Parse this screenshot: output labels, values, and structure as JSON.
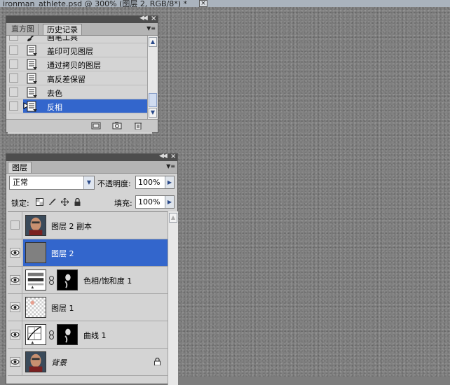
{
  "document": {
    "title": "ironman_athlete.psd @ 300% (图层 2, RGB/8*) *",
    "close_glyph": "×"
  },
  "history_panel": {
    "tabs": [
      {
        "label": "直方图",
        "active": false
      },
      {
        "label": "历史记录",
        "active": true
      }
    ],
    "items": [
      {
        "label": "画笔工具",
        "icon": "brush-icon",
        "selected": false
      },
      {
        "label": "盖印可见图层",
        "icon": "history-state-icon",
        "selected": false
      },
      {
        "label": "通过拷贝的图层",
        "icon": "history-state-icon",
        "selected": false
      },
      {
        "label": "高反差保留",
        "icon": "history-state-icon",
        "selected": false
      },
      {
        "label": "去色",
        "icon": "history-state-icon",
        "selected": false
      },
      {
        "label": "反相",
        "icon": "history-state-icon",
        "selected": true
      }
    ],
    "footer_icons": [
      "new-document-from-state-icon",
      "snapshot-camera-icon",
      "trash-icon"
    ]
  },
  "layers_panel": {
    "tab_label": "图层",
    "blend_mode": "正常",
    "opacity_label": "不透明度:",
    "opacity_value": "100%",
    "lock_label": "锁定:",
    "fill_label": "填充:",
    "fill_value": "100%",
    "layers": [
      {
        "name": "图层 2 副本",
        "visible": false,
        "selected": false,
        "thumb": "photo"
      },
      {
        "name": "图层 2",
        "visible": true,
        "selected": true,
        "thumb": "gray"
      },
      {
        "name": "色相/饱和度 1",
        "visible": true,
        "selected": false,
        "thumb": "adjust-hue",
        "has_mask": true
      },
      {
        "name": "图层 1",
        "visible": true,
        "selected": false,
        "thumb": "transparent"
      },
      {
        "name": "曲线 1",
        "visible": true,
        "selected": false,
        "thumb": "curves",
        "has_mask": true
      },
      {
        "name": "背景",
        "visible": true,
        "selected": false,
        "thumb": "photo",
        "locked": true
      }
    ]
  },
  "colors": {
    "selection": "#3366cc",
    "panel_bg": "#d4d4d4",
    "canvas": "#7f7f7f"
  }
}
